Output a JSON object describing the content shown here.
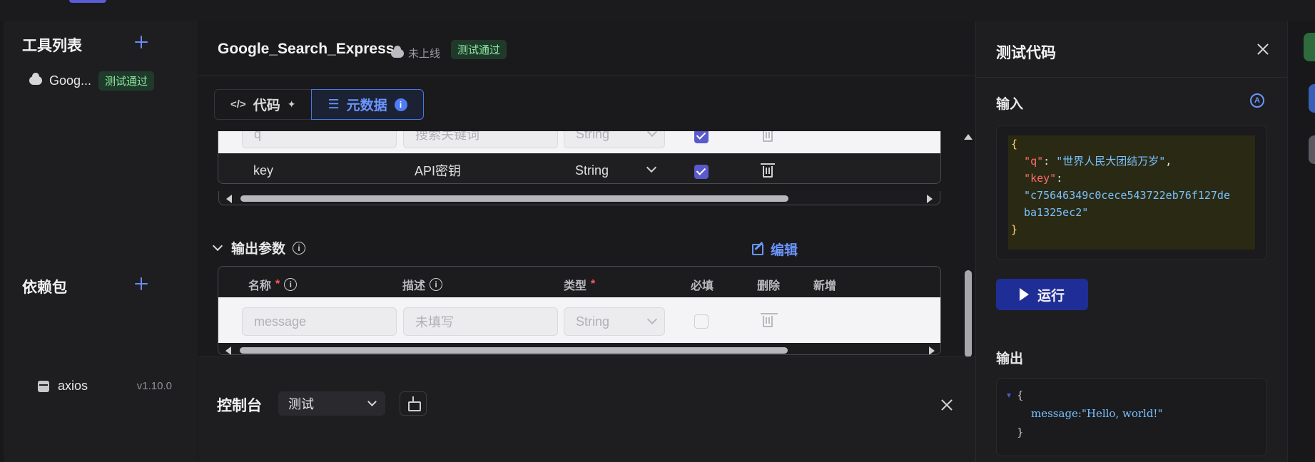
{
  "sidebar": {
    "tools_title": "工具列表",
    "tool_item": {
      "name": "Goog...",
      "status": "测试通过"
    },
    "deps_title": "依赖包",
    "dep_item": {
      "name": "axios",
      "version": "v1.10.0"
    }
  },
  "main": {
    "title": "Google_Search_Express",
    "cloud_status": "未上线",
    "test_badge": "测试通过",
    "tabs": [
      {
        "label": "代码",
        "icon": "code-icon"
      },
      {
        "label": "元数据",
        "icon": "sliders-icon",
        "info": "i"
      }
    ],
    "input_table": {
      "rows": [
        {
          "name": "q",
          "desc": "搜索关键词",
          "type": "String",
          "required": true
        },
        {
          "name": "key",
          "desc": "API密钥",
          "type": "String",
          "required": true
        }
      ]
    },
    "output_section": {
      "title": "输出参数",
      "info": "i",
      "edit_label": "编辑",
      "headers": {
        "name": "名称",
        "desc": "描述",
        "type": "类型",
        "required": "必填",
        "delete": "删除",
        "add": "新增",
        "required_mark": "*",
        "info": "i"
      },
      "rows": [
        {
          "name_placeholder": "message",
          "desc_placeholder": "未填写",
          "type": "String",
          "required": false
        }
      ]
    }
  },
  "console": {
    "title": "控制台",
    "mode": "测试"
  },
  "test_panel": {
    "title": "测试代码",
    "input_label": "输入",
    "a_icon": "A",
    "input_json": {
      "open": "{",
      "q_key": "\"q\"",
      "q_val": "\"世界人民大团结万岁\"",
      "key_key": "\"key\"",
      "key_val_1": "\"c75646349c0cece543722eb76f127de",
      "key_val_2": "ba1325ec2\"",
      "close": "}"
    },
    "run_label": "运行",
    "output_label": "输出",
    "output": {
      "toggle": "▾",
      "open": "{",
      "line": "message:\"Hello, world!\"",
      "close": "}"
    }
  },
  "colors": {
    "accent": "#6b95ff",
    "success": "#8ee6a0",
    "run_button": "#1f2e96",
    "required": "#ff5a5a"
  }
}
